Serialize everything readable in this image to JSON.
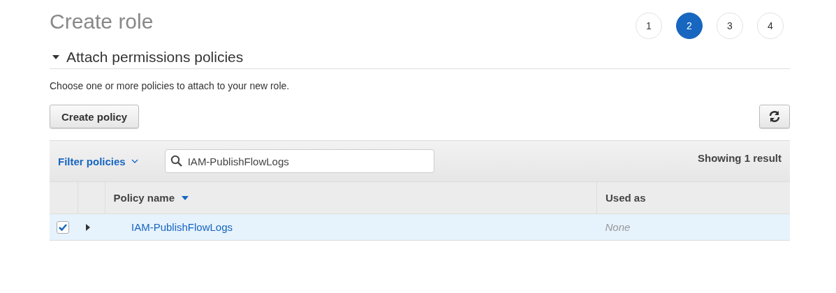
{
  "title": "Create role",
  "steps": [
    {
      "label": "1",
      "selected": false
    },
    {
      "label": "2",
      "selected": true
    },
    {
      "label": "3",
      "selected": false
    },
    {
      "label": "4",
      "selected": false
    }
  ],
  "section": {
    "title": "Attach permissions policies",
    "expanded": true
  },
  "description": "Choose one or more policies to attach to your new role.",
  "create_policy_button": "Create policy",
  "filter": {
    "label": "Filter policies",
    "search_value": "IAM-PublishFlowLogs",
    "result_count": "Showing 1 result"
  },
  "table": {
    "columns": [
      {
        "label": "Policy name",
        "sorted": true
      },
      {
        "label": "Used as",
        "sorted": false
      }
    ],
    "rows": [
      {
        "checked": true,
        "selected": true,
        "expanded": false,
        "policy_name": "IAM-PublishFlowLogs",
        "used_as": "None"
      }
    ]
  }
}
